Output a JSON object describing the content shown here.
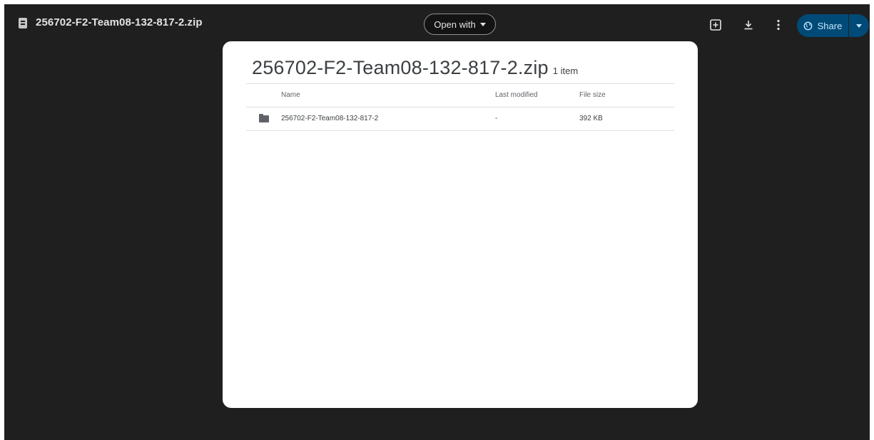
{
  "topbar": {
    "file_title": "256702-F2-Team08-132-817-2.zip",
    "open_with_label": "Open with",
    "share_label": "Share",
    "icons": [
      "file-icon",
      "add-shortcut-icon",
      "download-icon",
      "more-icon",
      "share-globe-icon",
      "chevron-down-icon"
    ]
  },
  "card": {
    "title": "256702-F2-Team08-132-817-2.zip",
    "item_count": "1 item",
    "columns": {
      "name": "Name",
      "modified": "Last modified",
      "size": "File size"
    },
    "rows": [
      {
        "name": "256702-F2-Team08-132-817-2",
        "modified": "-",
        "size": "392 KB",
        "icon": "folder-icon"
      }
    ]
  },
  "colors": {
    "background": "#1f1f1f",
    "share_button": "#004a77",
    "share_text": "#c2e7ff",
    "card": "#ffffff"
  }
}
